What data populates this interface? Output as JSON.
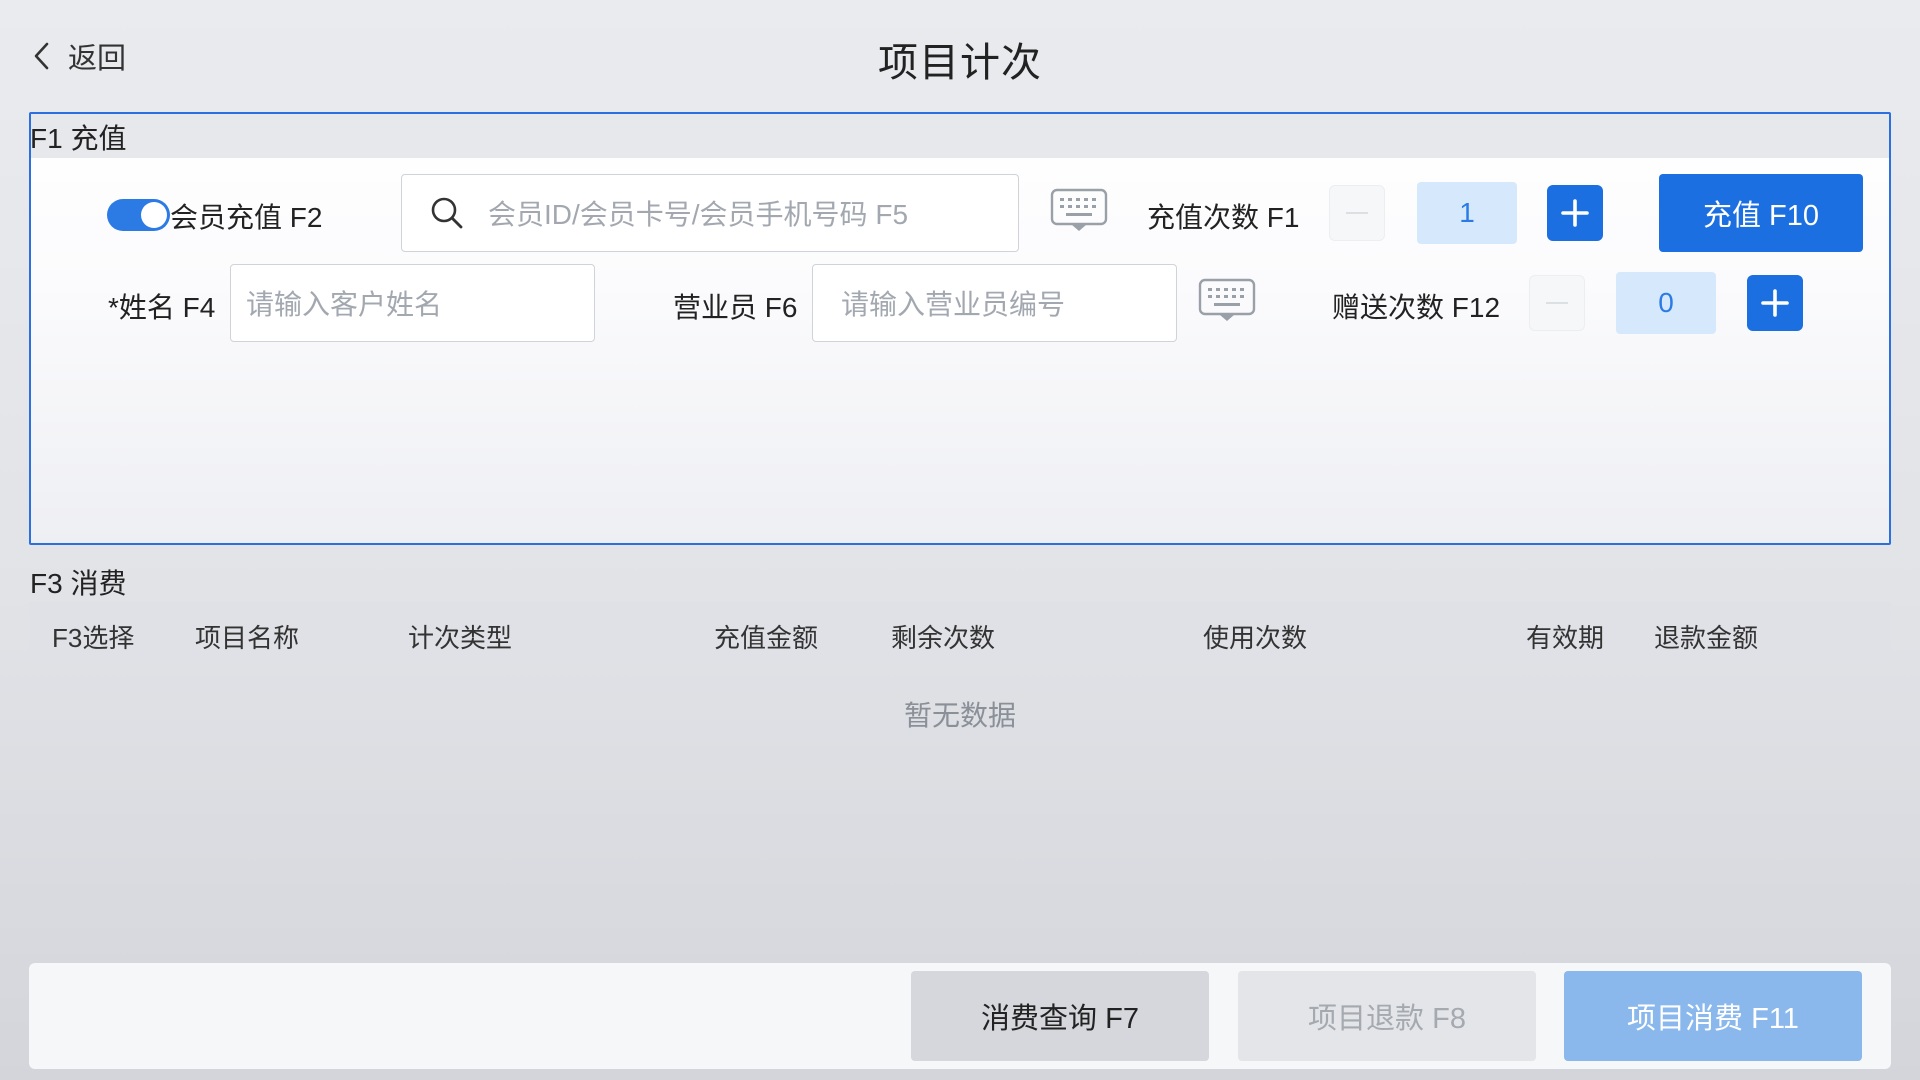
{
  "header": {
    "back_label": "返回",
    "title": "项目计次"
  },
  "recharge": {
    "section_label": "F1 充值",
    "member_toggle_label": "会员充值 F2",
    "member_toggle_on": true,
    "member_search_placeholder": "会员ID/会员卡号/会员手机号码 F5",
    "recharge_count_label": "充值次数 F1",
    "recharge_count_value": "1",
    "recharge_button": "充值 F10",
    "name_label": "*姓名 F4",
    "name_placeholder": "请输入客户姓名",
    "staff_label": "营业员 F6",
    "staff_placeholder": "请输入营业员编号",
    "gift_count_label": "赠送次数 F12",
    "gift_count_value": "0"
  },
  "consume": {
    "section_label": "F3 消费",
    "columns": [
      "F3选择",
      "项目名称",
      "计次类型",
      "充值金额",
      "剩余次数",
      "使用次数",
      "有效期",
      "退款金额"
    ],
    "empty_text": "暂无数据"
  },
  "footer": {
    "query_button": "消费查询 F7",
    "refund_button": "项目退款 F8",
    "consume_button": "项目消费 F11"
  },
  "colors": {
    "primary": "#1b6fe0",
    "toggle_on": "#2c7be5",
    "stepper_value_bg": "#d6e8fb",
    "consume_button_disabled": "#8ab8ec"
  },
  "icons": {
    "back": "chevron-left-icon",
    "search": "search-icon",
    "keyboard": "keyboard-icon",
    "minus": "minus-icon",
    "plus": "plus-icon"
  }
}
